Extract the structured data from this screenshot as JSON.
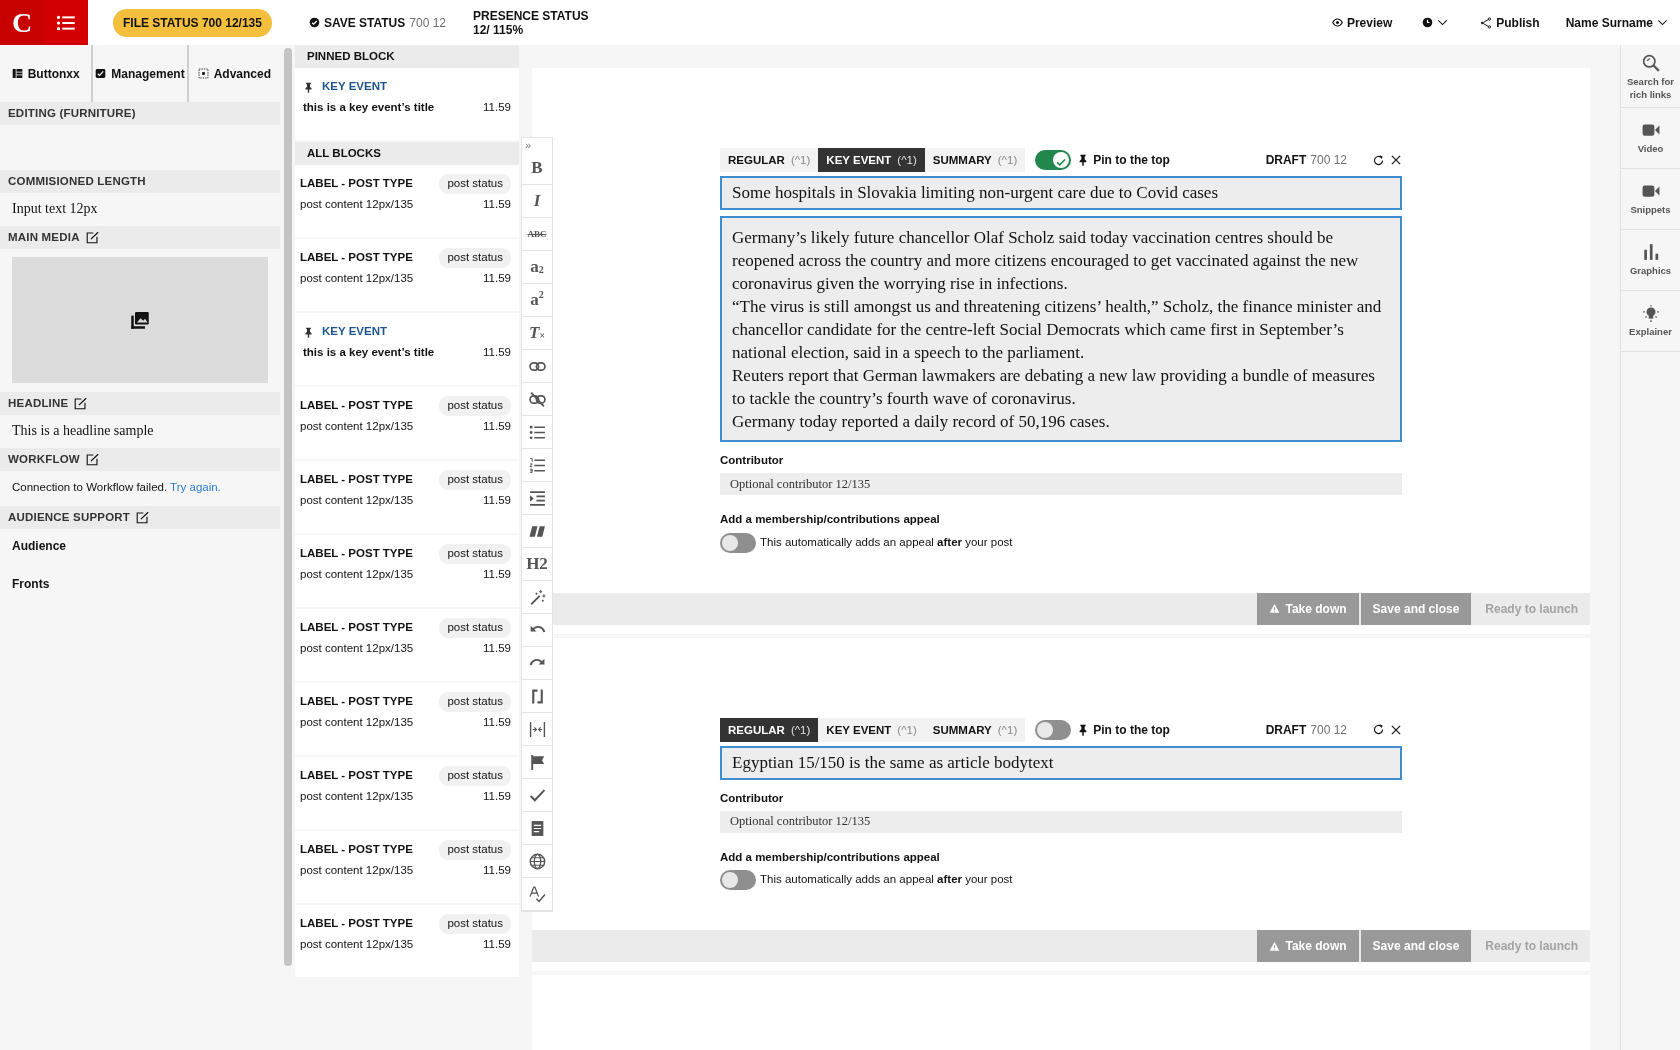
{
  "topbar": {
    "logo": "C",
    "file_status": "FILE STATUS 700 12/135",
    "save_status": {
      "label": "SAVE STATUS",
      "value": "700 12"
    },
    "presence": {
      "label": "PRESENCE STATUS",
      "value": "12/ 115%"
    },
    "preview": "Preview",
    "publish": "Publish",
    "user": "Name Surname"
  },
  "left_panel": {
    "tabs": [
      {
        "label": "Buttonxx",
        "kind": "columns"
      },
      {
        "label": "Management",
        "kind": "checkbox"
      },
      {
        "label": "Advanced",
        "kind": "dotted"
      }
    ],
    "sections": [
      {
        "title": "EDITING (FURNITURE)",
        "editable": false,
        "kind": "empty"
      },
      {
        "title": "COMMISIONED LENGTH",
        "editable": false,
        "kind": "text",
        "value": "Input text 12px"
      },
      {
        "title": "MAIN MEDIA",
        "editable": true,
        "kind": "media"
      },
      {
        "title": "HEADLINE",
        "editable": true,
        "kind": "text",
        "value": "This is a headline sample"
      },
      {
        "title": "WORKFLOW",
        "editable": true,
        "kind": "message",
        "message": "Connection to Workflow failed.",
        "link": "Try again."
      },
      {
        "title": "AUDIENCE SUPPORT",
        "editable": true,
        "kind": "links",
        "items": [
          "Audience",
          "Fronts"
        ]
      }
    ]
  },
  "blocks": [
    {
      "title": "PINNED BLOCK",
      "items": [
        {
          "kind": "key_event",
          "label": "KEY EVENT",
          "title": "this is a key event’s title",
          "time": "11.59"
        }
      ]
    },
    {
      "title": "ALL BLOCKS",
      "items": [
        {
          "kind": "post",
          "label": "LABEL - POST TYPE",
          "status": "post status",
          "content": "post content 12px/135",
          "time": "11.59"
        },
        {
          "kind": "post",
          "label": "LABEL - POST TYPE",
          "status": "post status",
          "content": "post content 12px/135",
          "time": "11.59"
        },
        {
          "kind": "key_event",
          "label": "KEY EVENT",
          "title": "this is a key event’s title",
          "time": "11.59"
        },
        {
          "kind": "post",
          "label": "LABEL - POST TYPE",
          "status": "post status",
          "content": "post content 12px/135",
          "time": "11.59"
        },
        {
          "kind": "post",
          "label": "LABEL - POST TYPE",
          "status": "post status",
          "content": "post content 12px/135",
          "time": "11.59"
        },
        {
          "kind": "post",
          "label": "LABEL - POST TYPE",
          "status": "post status",
          "content": "post content 12px/135",
          "time": "11.59"
        },
        {
          "kind": "post",
          "label": "LABEL - POST TYPE",
          "status": "post status",
          "content": "post content 12px/135",
          "time": "11.59"
        },
        {
          "kind": "post",
          "label": "LABEL - POST TYPE",
          "status": "post status",
          "content": "post content 12px/135",
          "time": "11.59"
        },
        {
          "kind": "post",
          "label": "LABEL - POST TYPE",
          "status": "post status",
          "content": "post content 12px/135",
          "time": "11.59"
        },
        {
          "kind": "post",
          "label": "LABEL - POST TYPE",
          "status": "post status",
          "content": "post content 12px/135",
          "time": "11.59"
        },
        {
          "kind": "post",
          "label": "LABEL - POST TYPE",
          "status": "post status",
          "content": "post content 12px/135",
          "time": "11.59"
        }
      ]
    }
  ],
  "toolbar": {
    "collapse": "»",
    "tools": [
      {
        "kind": "bold",
        "label": "B"
      },
      {
        "kind": "italic",
        "label": "I"
      },
      {
        "kind": "strike",
        "label": "ABC"
      },
      {
        "kind": "bold",
        "label": "a$_{2}$"
      },
      {
        "kind": "bold",
        "label": "a$^{2}$"
      },
      {
        "kind": "italic",
        "label": "T$_{×}$"
      },
      {
        "kind": "link"
      },
      {
        "kind": "unlink"
      },
      {
        "kind": "bullets"
      },
      {
        "kind": "numbers"
      },
      {
        "kind": "indent"
      },
      {
        "kind": "quote"
      },
      {
        "kind": "bold",
        "label": "H2"
      },
      {
        "kind": "wand"
      },
      {
        "kind": "undo"
      },
      {
        "kind": "redo"
      },
      {
        "kind": "bracket"
      },
      {
        "kind": "spacing"
      },
      {
        "kind": "flag"
      },
      {
        "kind": "check"
      },
      {
        "kind": "document"
      },
      {
        "kind": "globe"
      },
      {
        "kind": "spell"
      }
    ]
  },
  "posts": [
    {
      "tabs": [
        {
          "label": "REGULAR",
          "shortcut": "(^1)",
          "selected": false
        },
        {
          "label": "KEY EVENT",
          "shortcut": "(^1)",
          "selected": true
        },
        {
          "label": "SUMMARY",
          "shortcut": "(^1)",
          "selected": false
        }
      ],
      "pinned": true,
      "pin_label": "Pin to the top",
      "draft": {
        "label": "DRAFT",
        "value": "700 12"
      },
      "title": "Some hospitals in Slovakia limiting non-urgent care due to Covid cases",
      "body": [
        "Germany’s likely future chancellor Olaf Scholz said today vaccination centres should be reopened across the country and more citizens encouraged to get vaccinated against the new coronavirus given the worrying rise in infections.",
        "“The virus is still amongst us and threatening citizens’ health,” Scholz, the finance minister and chancellor candidate for the centre-left Social Democrats which came first in September’s national election, said in a speech to the parliament.",
        "Reuters report that German lawmakers are debating a new law providing a bundle of measures to tackle the country’s fourth wave of coronavirus.",
        "Germany today reported a daily record of 50,196 cases."
      ],
      "contributor": {
        "label": "Contributor",
        "placeholder": "Optional contributor 12/135"
      },
      "appeal": {
        "label": "Add a membership/contributions appeal",
        "on": false,
        "text": "This automatically adds an appeal **after** your post"
      },
      "actions": [
        {
          "kind": "warning",
          "label": "Take down",
          "disabled": false
        },
        {
          "kind": "plain",
          "label": "Save and close",
          "disabled": false
        },
        {
          "kind": "plain",
          "label": "Ready to launch",
          "disabled": true
        }
      ]
    },
    {
      "tabs": [
        {
          "label": "REGULAR",
          "shortcut": "(^1)",
          "selected": true
        },
        {
          "label": "KEY EVENT",
          "shortcut": "(^1)",
          "selected": false
        },
        {
          "label": "SUMMARY",
          "shortcut": "(^1)",
          "selected": false
        }
      ],
      "pinned": false,
      "pin_label": "Pin to the top",
      "draft": {
        "label": "DRAFT",
        "value": "700 12"
      },
      "title": "Egyptian 15/150 is the same as article bodytext",
      "contributor": {
        "label": "Contributor",
        "placeholder": "Optional contributor 12/135"
      },
      "appeal": {
        "label": "Add a membership/contributions appeal",
        "on": false,
        "text": "This automatically adds an appeal **after** your post"
      },
      "actions": [
        {
          "kind": "warning",
          "label": "Take down",
          "disabled": false
        },
        {
          "kind": "plain",
          "label": "Save and close",
          "disabled": false
        },
        {
          "kind": "plain",
          "label": "Ready to launch",
          "disabled": true
        }
      ]
    }
  ],
  "right_sidebar": [
    {
      "kind": "search",
      "label": "Search for rich links"
    },
    {
      "kind": "video",
      "label": "Video"
    },
    {
      "kind": "video",
      "label": "Snippets"
    },
    {
      "kind": "chart",
      "label": "Graphics"
    },
    {
      "kind": "bulb",
      "label": "Explainer"
    }
  ]
}
